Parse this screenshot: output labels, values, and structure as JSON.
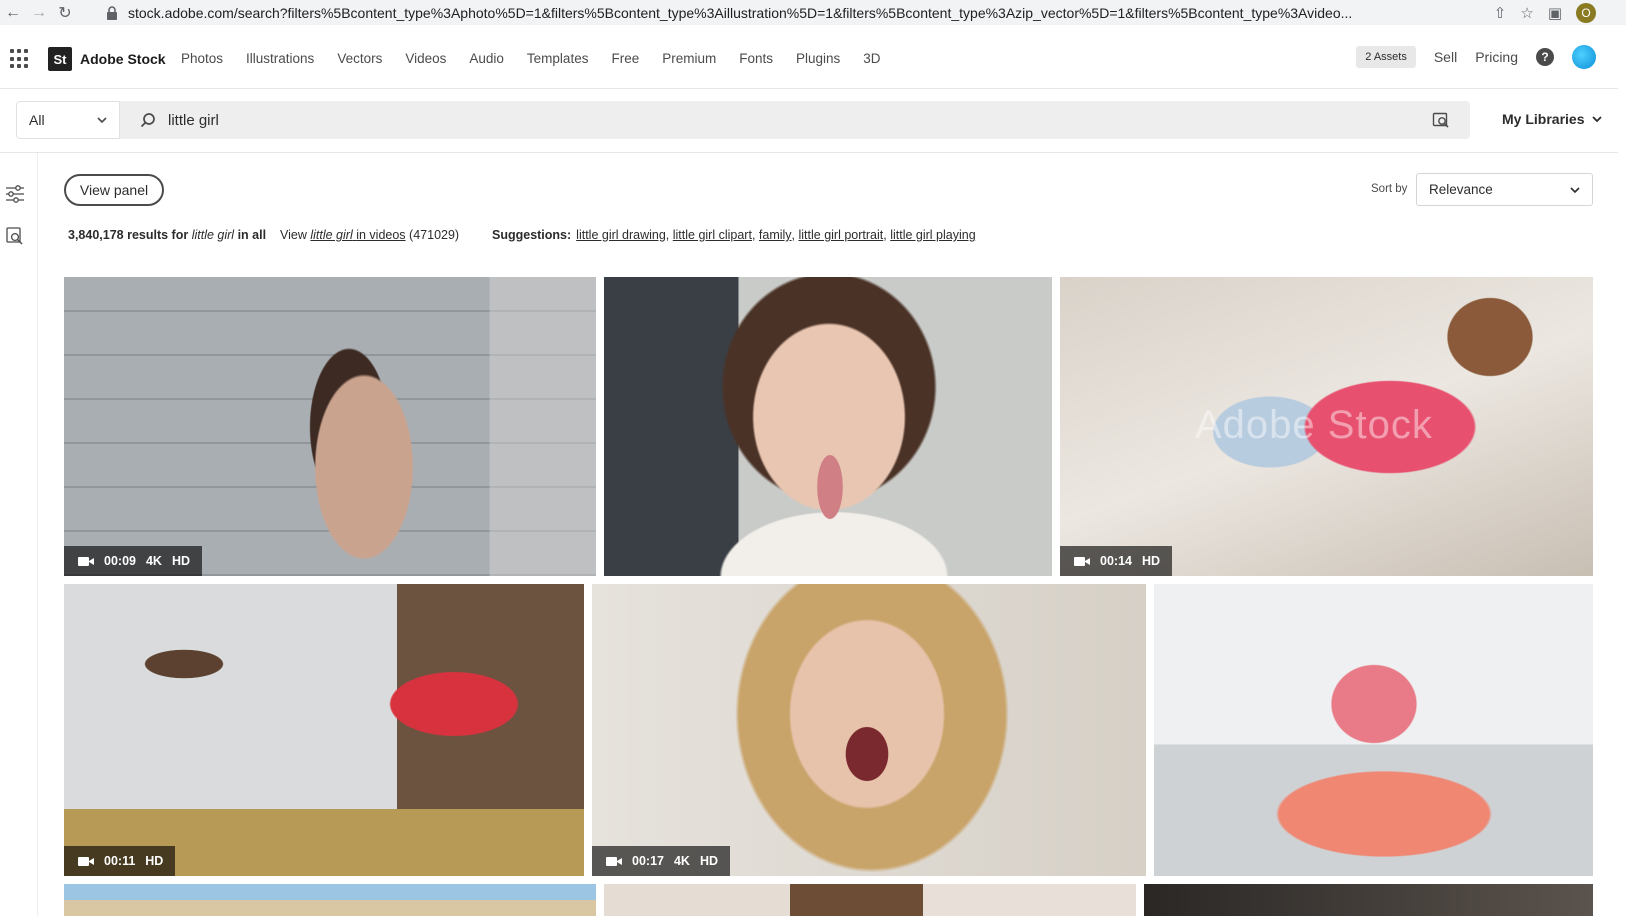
{
  "browser": {
    "url": "stock.adobe.com/search?filters%5Bcontent_type%3Aphoto%5D=1&filters%5Bcontent_type%3Aillustration%5D=1&filters%5Bcontent_type%3Azip_vector%5D=1&filters%5Bcontent_type%3Avideo...",
    "profile_initial": "O"
  },
  "header": {
    "brand_logo": "St",
    "brand_name": "Adobe Stock",
    "nav": [
      "Photos",
      "Illustrations",
      "Vectors",
      "Videos",
      "Audio",
      "Templates",
      "Free",
      "Premium",
      "Fonts",
      "Plugins",
      "3D"
    ],
    "assets_label": "2 Assets",
    "sell": "Sell",
    "pricing": "Pricing",
    "help": "?"
  },
  "search": {
    "filter_value": "All",
    "query": "little girl",
    "my_libraries": "My Libraries"
  },
  "toolbar": {
    "view_panel": "View panel",
    "sort_label": "Sort by",
    "sort_value": "Relevance"
  },
  "results": {
    "count": "3,840,178",
    "results_for": "results for",
    "query": "little girl",
    "in_all": "in all",
    "view_word": "View",
    "view_query": "little girl",
    "in_videos": "in videos",
    "video_count": "(471029)",
    "suggestions_label": "Suggestions:",
    "suggestions": [
      "little girl drawing",
      "little girl clipart",
      "family",
      "little girl portrait",
      "little girl playing"
    ]
  },
  "grid": [
    {
      "duration": "00:09",
      "quality": [
        "4K",
        "HD"
      ],
      "video": true
    },
    {
      "video": false
    },
    {
      "duration": "00:14",
      "quality": [
        "HD"
      ],
      "video": true,
      "watermark": "Adobe Stock"
    },
    {
      "duration": "00:11",
      "quality": [
        "HD"
      ],
      "video": true
    },
    {
      "duration": "00:17",
      "quality": [
        "4K",
        "HD"
      ],
      "video": true
    },
    {
      "video": false
    },
    {
      "video": false
    },
    {
      "video": false
    },
    {
      "video": false
    }
  ],
  "colors": {
    "accent_dark": "#2c2c2c",
    "search_bg": "#eeeeee",
    "avatar": "#0a8ed8"
  }
}
